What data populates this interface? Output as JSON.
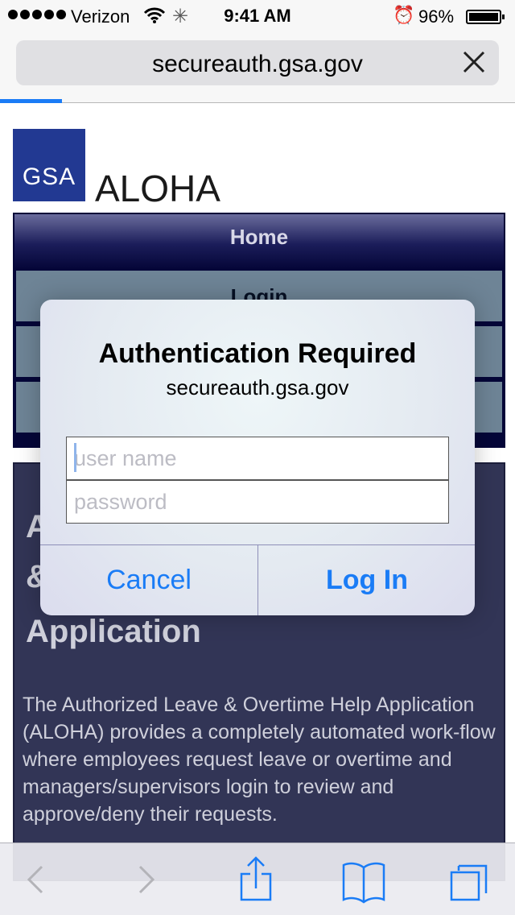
{
  "status_bar": {
    "carrier": "Verizon",
    "time": "9:41 AM",
    "battery_percent": "96%",
    "battery_level": 0.96
  },
  "browser": {
    "url": "secureauth.gsa.gov",
    "load_progress": 0.12
  },
  "page": {
    "logo_text": "GSA",
    "app_title": "ALOHA",
    "nav": {
      "home": "Home",
      "login": "Login"
    },
    "content": {
      "partial_line1": "A",
      "partial_line2": "&",
      "heading_visible": "Application",
      "description": "The Authorized Leave & Overtime Help Application (ALOHA) provides a completely automated work-flow where employees request leave or overtime and managers/supervisors login to review and approve/deny their requests."
    }
  },
  "dialog": {
    "title": "Authentication Required",
    "host": "secureauth.gsa.gov",
    "username": {
      "value": "",
      "placeholder": "user name"
    },
    "password": {
      "value": "",
      "placeholder": "password"
    },
    "cancel_label": "Cancel",
    "login_label": "Log In"
  },
  "toolbar": {
    "icons": [
      "back-icon",
      "forward-icon",
      "share-icon",
      "bookmarks-icon",
      "tabs-icon"
    ]
  },
  "colors": {
    "accent": "#1a7cf6",
    "gsa_blue": "#223992",
    "nav_dark": "#050638",
    "nav_row": "#6e8496",
    "content_bg": "#323556"
  }
}
